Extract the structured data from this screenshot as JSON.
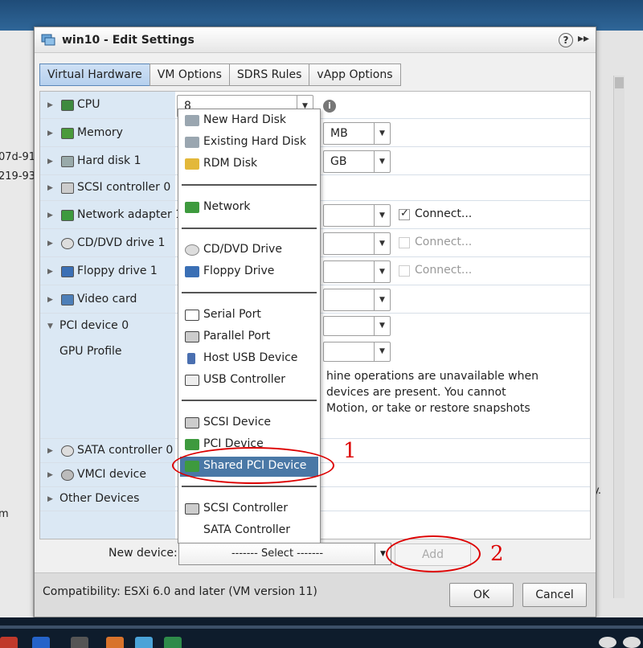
{
  "background": {
    "left_fragments": [
      "07d-91",
      "219-93",
      "m"
    ],
    "right_fragment": "y."
  },
  "dialog": {
    "title": "win10 - Edit Settings",
    "help": "?",
    "expand": "▸▸"
  },
  "tabs": [
    "Virtual Hardware",
    "VM Options",
    "SDRS Rules",
    "vApp Options"
  ],
  "hardware": {
    "cpu": {
      "label": "CPU",
      "value": "8"
    },
    "memory": {
      "label": "Memory",
      "unit": "MB"
    },
    "harddisk": {
      "label": "Hard disk 1",
      "unit": "GB"
    },
    "scsi": {
      "label": "SCSI controller 0"
    },
    "network": {
      "label": "Network adapter 1",
      "connect": "Connect...",
      "connected": true
    },
    "cdvd": {
      "label": "CD/DVD drive 1",
      "connect": "Connect...",
      "connected": false
    },
    "floppy": {
      "label": "Floppy drive 1",
      "connect": "Connect...",
      "connected": false
    },
    "video": {
      "label": "Video card"
    },
    "pci": {
      "label": "PCI device 0"
    },
    "gpu": {
      "label": "GPU Profile"
    },
    "warning_lines": [
      "hine operations are unavailable when",
      "devices are present. You cannot",
      "Motion, or take or restore snapshots"
    ],
    "sata": {
      "label": "SATA controller 0"
    },
    "vmci": {
      "label": "VMCI device"
    },
    "other": {
      "label": "Other Devices"
    }
  },
  "menu": {
    "items": [
      {
        "label": "New Hard Disk",
        "icon": "disk-icon"
      },
      {
        "label": "Existing Hard Disk",
        "icon": "disk-icon"
      },
      {
        "label": "RDM Disk",
        "icon": "rdm-icon"
      },
      {
        "label": "Network",
        "icon": "network-icon"
      },
      {
        "label": "CD/DVD Drive",
        "icon": "cd-icon"
      },
      {
        "label": "Floppy Drive",
        "icon": "floppy-icon"
      },
      {
        "label": "Serial Port",
        "icon": "serial-icon"
      },
      {
        "label": "Parallel Port",
        "icon": "parallel-icon"
      },
      {
        "label": "Host USB Device",
        "icon": "usb-device-icon"
      },
      {
        "label": "USB Controller",
        "icon": "usb-icon"
      },
      {
        "label": "SCSI Device",
        "icon": "scsi-icon"
      },
      {
        "label": "PCI Device",
        "icon": "pci-icon"
      },
      {
        "label": "Shared PCI Device",
        "icon": "pci-icon",
        "selected": true
      },
      {
        "label": "SCSI Controller",
        "icon": "scsi-icon"
      },
      {
        "label": "SATA Controller",
        "icon": ""
      }
    ]
  },
  "new_device": {
    "label": "New device:",
    "select": "------- Select -------",
    "add": "Add"
  },
  "footer": {
    "compat": "Compatibility: ESXi 6.0 and later (VM version 11)",
    "ok": "OK",
    "cancel": "Cancel"
  },
  "annotations": {
    "one": "1",
    "two": "2"
  },
  "colors": {
    "accent": "#4a78a6",
    "annotation": "#dd0000",
    "label_bg": "#dbe8f4"
  }
}
